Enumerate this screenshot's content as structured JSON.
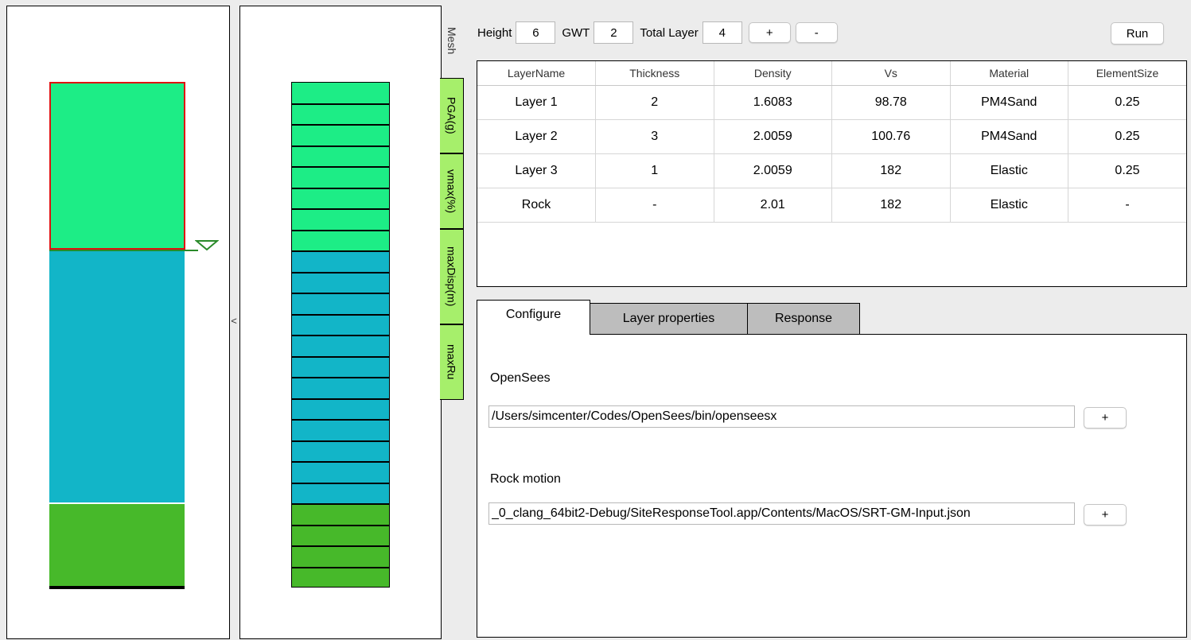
{
  "toolbar": {
    "height_label": "Height",
    "height_value": "6",
    "gwt_label": "GWT",
    "gwt_value": "2",
    "total_layer_label": "Total Layer",
    "total_layer_value": "4",
    "add_label": "+",
    "remove_label": "-",
    "run_label": "Run"
  },
  "side_tabs": {
    "mesh": "Mesh",
    "pga": "PGA(g)",
    "vmax": "vmax(%)",
    "maxdisp": "maxDisp(m)",
    "maxru": "maxRu"
  },
  "collapse_label": "<",
  "table": {
    "headers": [
      "LayerName",
      "Thickness",
      "Density",
      "Vs",
      "Material",
      "ElementSize"
    ],
    "rows": [
      [
        "Layer 1",
        "2",
        "1.6083",
        "98.78",
        "PM4Sand",
        "0.25"
      ],
      [
        "Layer 2",
        "3",
        "2.0059",
        "100.76",
        "PM4Sand",
        "0.25"
      ],
      [
        "Layer 3",
        "1",
        "2.0059",
        "182",
        "Elastic",
        "0.25"
      ],
      [
        "Rock",
        "-",
        "2.01",
        "182",
        "Elastic",
        "-"
      ]
    ]
  },
  "tabs": {
    "configure": "Configure",
    "layer_properties": "Layer properties",
    "response": "Response"
  },
  "configure": {
    "opensees_label": "OpenSees",
    "opensees_path": "/Users/simcenter/Codes/OpenSees/bin/openseesx",
    "rock_motion_label": "Rock motion",
    "rock_motion_path": "_0_clang_64bit2-Debug/SiteResponseTool.app/Contents/MacOS/SRT-GM-Input.json",
    "browse_label": "+"
  },
  "mesh": {
    "elements_per_layer": [
      8,
      12,
      4
    ],
    "layer_colors": [
      "#1ded86",
      "#12b5c8",
      "#47b92a"
    ]
  },
  "colors": {
    "layer1": "#1ded86",
    "layer2": "#12b5c8",
    "layer3": "#47b92a",
    "selected_border": "#e01010",
    "water_table": "#2a8a2a",
    "tab_green": "#a6ef6b"
  }
}
